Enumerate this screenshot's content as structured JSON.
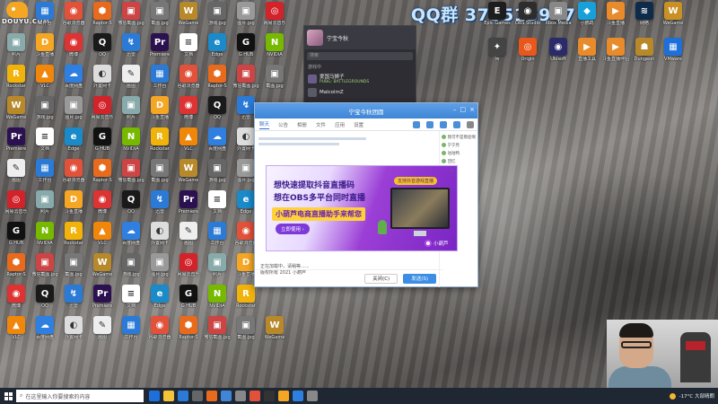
{
  "watermark": {
    "qq_group": "QQ群 375513947",
    "platform": "DOUYU.COM"
  },
  "desktop_icons": [
    {
      "label": "工作台",
      "color": "#2b7bd6",
      "glyph": "▦"
    },
    {
      "label": "谷歌浏览器",
      "color": "#e2513a",
      "glyph": "◉"
    },
    {
      "label": "Raptor-S",
      "color": "#e86a1c",
      "glyph": "⬢"
    },
    {
      "label": "微信截图.jpg",
      "color": "#c44",
      "glyph": "▣"
    },
    {
      "label": "截图.jpg",
      "color": "#777",
      "glyph": "▣"
    },
    {
      "label": "WeGame",
      "color": "#b8892a",
      "glyph": "W"
    },
    {
      "label": "游戏.jpg",
      "color": "#666",
      "glyph": "▣"
    },
    {
      "label": "图片.jpg",
      "color": "#999",
      "glyph": "▣"
    },
    {
      "label": "网易云音乐",
      "color": "#d3232a",
      "glyph": "◎"
    },
    {
      "label": "照片",
      "color": "#8aa",
      "glyph": "▣"
    },
    {
      "label": "斗鱼直播",
      "color": "#f5a623",
      "glyph": "D"
    },
    {
      "label": "微博",
      "color": "#d33",
      "glyph": "◉"
    },
    {
      "label": "QQ",
      "color": "#1a1a1a",
      "glyph": "Q"
    },
    {
      "label": "迅雷",
      "color": "#2b7bd6",
      "glyph": "↯"
    },
    {
      "label": "Premiere",
      "color": "#2b1150",
      "glyph": "Pr"
    },
    {
      "label": "文档",
      "color": "#fff",
      "glyph": "≡"
    },
    {
      "label": "Edge",
      "color": "#1a8ac9",
      "glyph": "e"
    },
    {
      "label": "G HUB",
      "color": "#111",
      "glyph": "G"
    },
    {
      "label": "NVIDIA",
      "color": "#76b900",
      "glyph": "N"
    },
    {
      "label": "Rockstar",
      "color": "#f1b30a",
      "glyph": "R"
    },
    {
      "label": "VLC",
      "color": "#f0860a",
      "glyph": "▲"
    },
    {
      "label": "百度网盘",
      "color": "#2f7fe0",
      "glyph": "☁"
    },
    {
      "label": "外置网卡",
      "color": "#ddd",
      "glyph": "◐"
    },
    {
      "label": "画图",
      "color": "#eee",
      "glyph": "✎"
    }
  ],
  "qq_panel": {
    "name": "宁宝今秋",
    "search_placeholder": "搜索",
    "section_label": "游戏中",
    "contacts": [
      {
        "name": "爱国马狮子",
        "status": "PUBG: BATTLEGROUNDS"
      },
      {
        "name": "MalcolmZ",
        "status": ""
      }
    ]
  },
  "chat_window": {
    "title": "宁宝今秋团圆",
    "tabs": [
      "聊天",
      "公告",
      "相册",
      "文件",
      "应用",
      "设置"
    ],
    "ad": {
      "line1": "想快速提取抖音直播码",
      "line2": "想在OBS多平台同时直播",
      "highlight": "小葫芦电商直播助手来帮您",
      "cta": "立即使用 ›",
      "badge": "支持抖音游戏直播",
      "brand": "小葫芦"
    },
    "notice_line1": "正在加载中，请稍等......",
    "notice_line2": "版权所有 2021 小葫芦",
    "members": [
      "我可不是叛徒啊",
      "宁宁月",
      "咕咕鸭",
      "回忆"
    ],
    "btn_close": "关闭(C)",
    "btn_send": "发送(S)"
  },
  "taskbar": {
    "search_placeholder": "在这里输入你要搜索的内容",
    "weather": "-17°C 大部晴朗",
    "pinned_colors": [
      "#1e6fd9",
      "#f3c33a",
      "#2b7bd6",
      "#666",
      "#e86a1c",
      "#3f86d6",
      "#888",
      "#e2513a",
      "#333",
      "#f5a623",
      "#2f7fe0",
      "#888"
    ]
  }
}
